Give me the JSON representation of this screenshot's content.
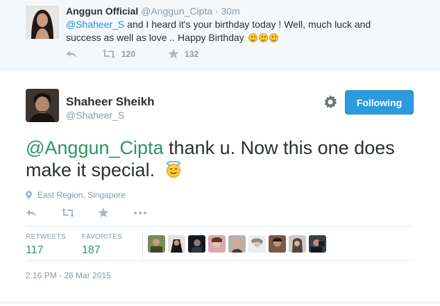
{
  "reply_tweet": {
    "author_name": "Anggun Official",
    "author_handle": "@Anggun_Cipta",
    "separator": "·",
    "time_ago": "30m",
    "mention": "@Shaheer_S",
    "text": " and I heard it's your birthday today ! Well, much luck and success as well as love .. Happy Birthday ",
    "retweet_count": "120",
    "favorite_count": "132",
    "emoji_name": "smiley-face"
  },
  "tweet": {
    "author_name": "Shaheer Sheikh",
    "author_handle": "@Shaheer_S",
    "follow_label": "Following",
    "mention": "@Anggun_Cipta",
    "text": " thank u. Now this one does make it special. ",
    "emoji_name": "smiling-face-with-halo",
    "location": "East Region, Singapore",
    "retweets_label": "RETWEETS",
    "retweets_count": "117",
    "favorites_label": "FAVORITES",
    "favorites_count": "187",
    "timestamp": "2:16 PM - 26 Mar 2015"
  },
  "colors": {
    "link_blue": "#1b95e0",
    "accent_green": "#2a9660",
    "follow_button": "#2b9bde",
    "muted_gray": "#8899a6"
  }
}
